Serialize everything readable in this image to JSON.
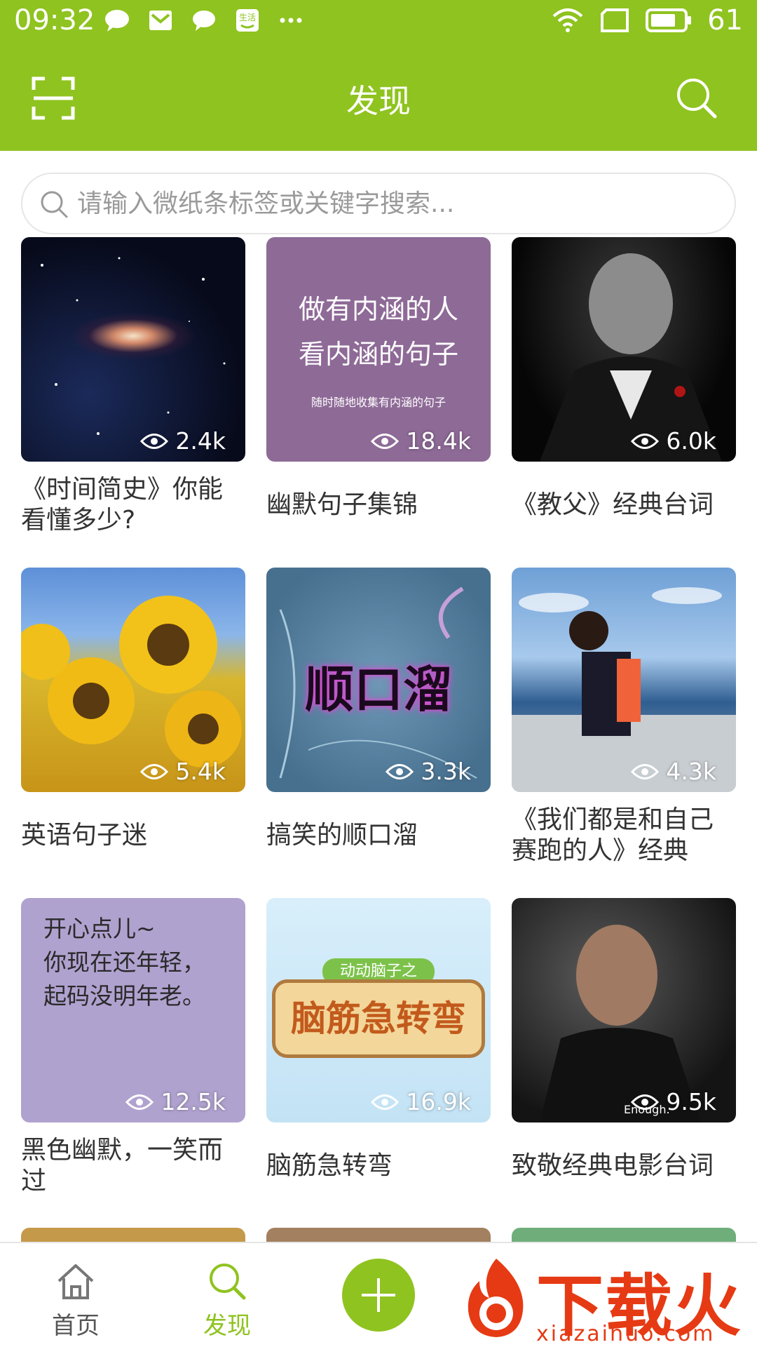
{
  "status_bar": {
    "time": "09:32",
    "battery": "61"
  },
  "header": {
    "title": "发现"
  },
  "search": {
    "placeholder": "请输入微纸条标签或关键字搜索..."
  },
  "cards": [
    {
      "title": "《时间简史》你能看懂多少?",
      "views": "2.4k",
      "lines": 2
    },
    {
      "title": "幽默句子集锦",
      "views": "18.4k",
      "image_text": [
        "做有内涵的人",
        "看内涵的句子",
        "随时随地收集有内涵的句子"
      ]
    },
    {
      "title": "《教父》经典台词",
      "views": "6.0k"
    },
    {
      "title": "英语句子迷",
      "views": "5.4k"
    },
    {
      "title": "搞笑的顺口溜",
      "views": "3.3k",
      "image_text": [
        "顺口溜"
      ]
    },
    {
      "title": "《我们都是和自己赛跑的人》经典句...",
      "views": "4.3k"
    },
    {
      "title": "黑色幽默，一笑而过",
      "views": "12.5k",
      "image_text": [
        "开心点儿~",
        "你现在还年轻，",
        "起码没明年老。"
      ]
    },
    {
      "title": "脑筋急转弯",
      "views": "16.9k",
      "image_text": [
        "动动脑子之",
        "脑筋急转弯"
      ]
    },
    {
      "title": "致敬经典电影台词",
      "views": "9.5k",
      "image_text": [
        "Enough."
      ]
    }
  ],
  "bottom_nav": [
    {
      "label": "首页",
      "icon": "home-icon",
      "active": false
    },
    {
      "label": "发现",
      "icon": "search-icon",
      "active": true
    }
  ],
  "watermark": {
    "text": "下载火",
    "domain": "xiazaihuo.com"
  },
  "colors": {
    "brand": "#8fc31f",
    "text": "#333333",
    "muted": "#9a9a9a"
  }
}
